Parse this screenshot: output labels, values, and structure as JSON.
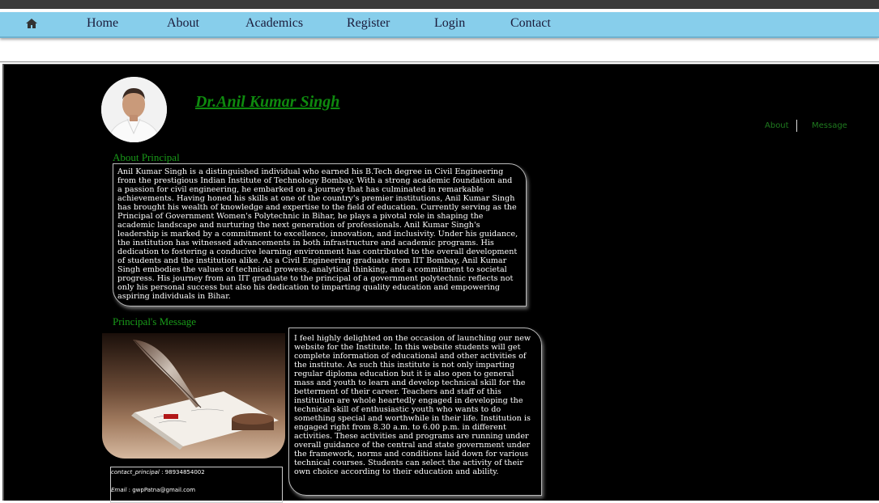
{
  "nav": {
    "items": [
      {
        "label": "Home"
      },
      {
        "label": "About"
      },
      {
        "label": "Academics"
      },
      {
        "label": "Register"
      },
      {
        "label": "Login"
      },
      {
        "label": "Contact"
      }
    ]
  },
  "profile": {
    "name": "Dr.Anil Kumar Singh"
  },
  "side_links": {
    "about": "About",
    "message": "Message"
  },
  "about_section": {
    "title": "About Principal",
    "text": "Anil Kumar Singh is a distinguished individual who earned his B.Tech degree in Civil Engineering from the prestigious Indian Institute of Technology Bombay. With a strong academic foundation and a passion for civil engineering, he embarked on a journey that has culminated in remarkable achievements. Having honed his skills at one of the country's premier institutions, Anil Kumar Singh has brought his wealth of knowledge and expertise to the field of education. Currently serving as the Principal of Government Women's Polytechnic in Bihar, he plays a pivotal role in shaping the academic landscape and nurturing the next generation of professionals. Anil Kumar Singh's leadership is marked by a commitment to excellence, innovation, and inclusivity. Under his guidance, the institution has witnessed advancements in both infrastructure and academic programs. His dedication to fostering a conducive learning environment has contributed to the overall development of students and the institution alike. As a Civil Engineering graduate from IIT Bombay, Anil Kumar Singh embodies the values of technical prowess, analytical thinking, and a commitment to societal progress. His journey from an IIT graduate to the principal of a government polytechnic reflects not only his personal success but also his dedication to imparting quality education and empowering aspiring individuals in Bihar."
  },
  "message_section": {
    "title": "Principal's Message",
    "text": "I feel highly delighted on the occasion of launching our new website for the Institute. In this website students will get complete information of educational and other activities of the institute. As such this institute is not only imparting regular diploma education but it is also open to general mass and youth to learn and develop technical skill for the betterment of their career. Teachers and staff of this institution are whole heartedly engaged in developing the technical skill of enthusiastic youth who wants to do something special and worthwhile in their life. Institution is engaged right from 8.30 a.m. to 6.00 p.m. in different activities. These activities and programs are running under overall guidance of the central and state government under the framework, norms and conditions laid down for various technical courses. Students can select the activity of their own choice according to their education and ability."
  },
  "contact": {
    "phone_label": "contact_principal",
    "phone_value": " : 98934854002",
    "email_label": "Email",
    "email_value": " : gwpPatna@gmail.com"
  },
  "icons": {
    "home": "home-icon"
  },
  "colors": {
    "nav_bg": "#87ceeb",
    "heading_green": "#199a19",
    "name_green": "#0e8a0e",
    "page_bg": "#000000"
  }
}
